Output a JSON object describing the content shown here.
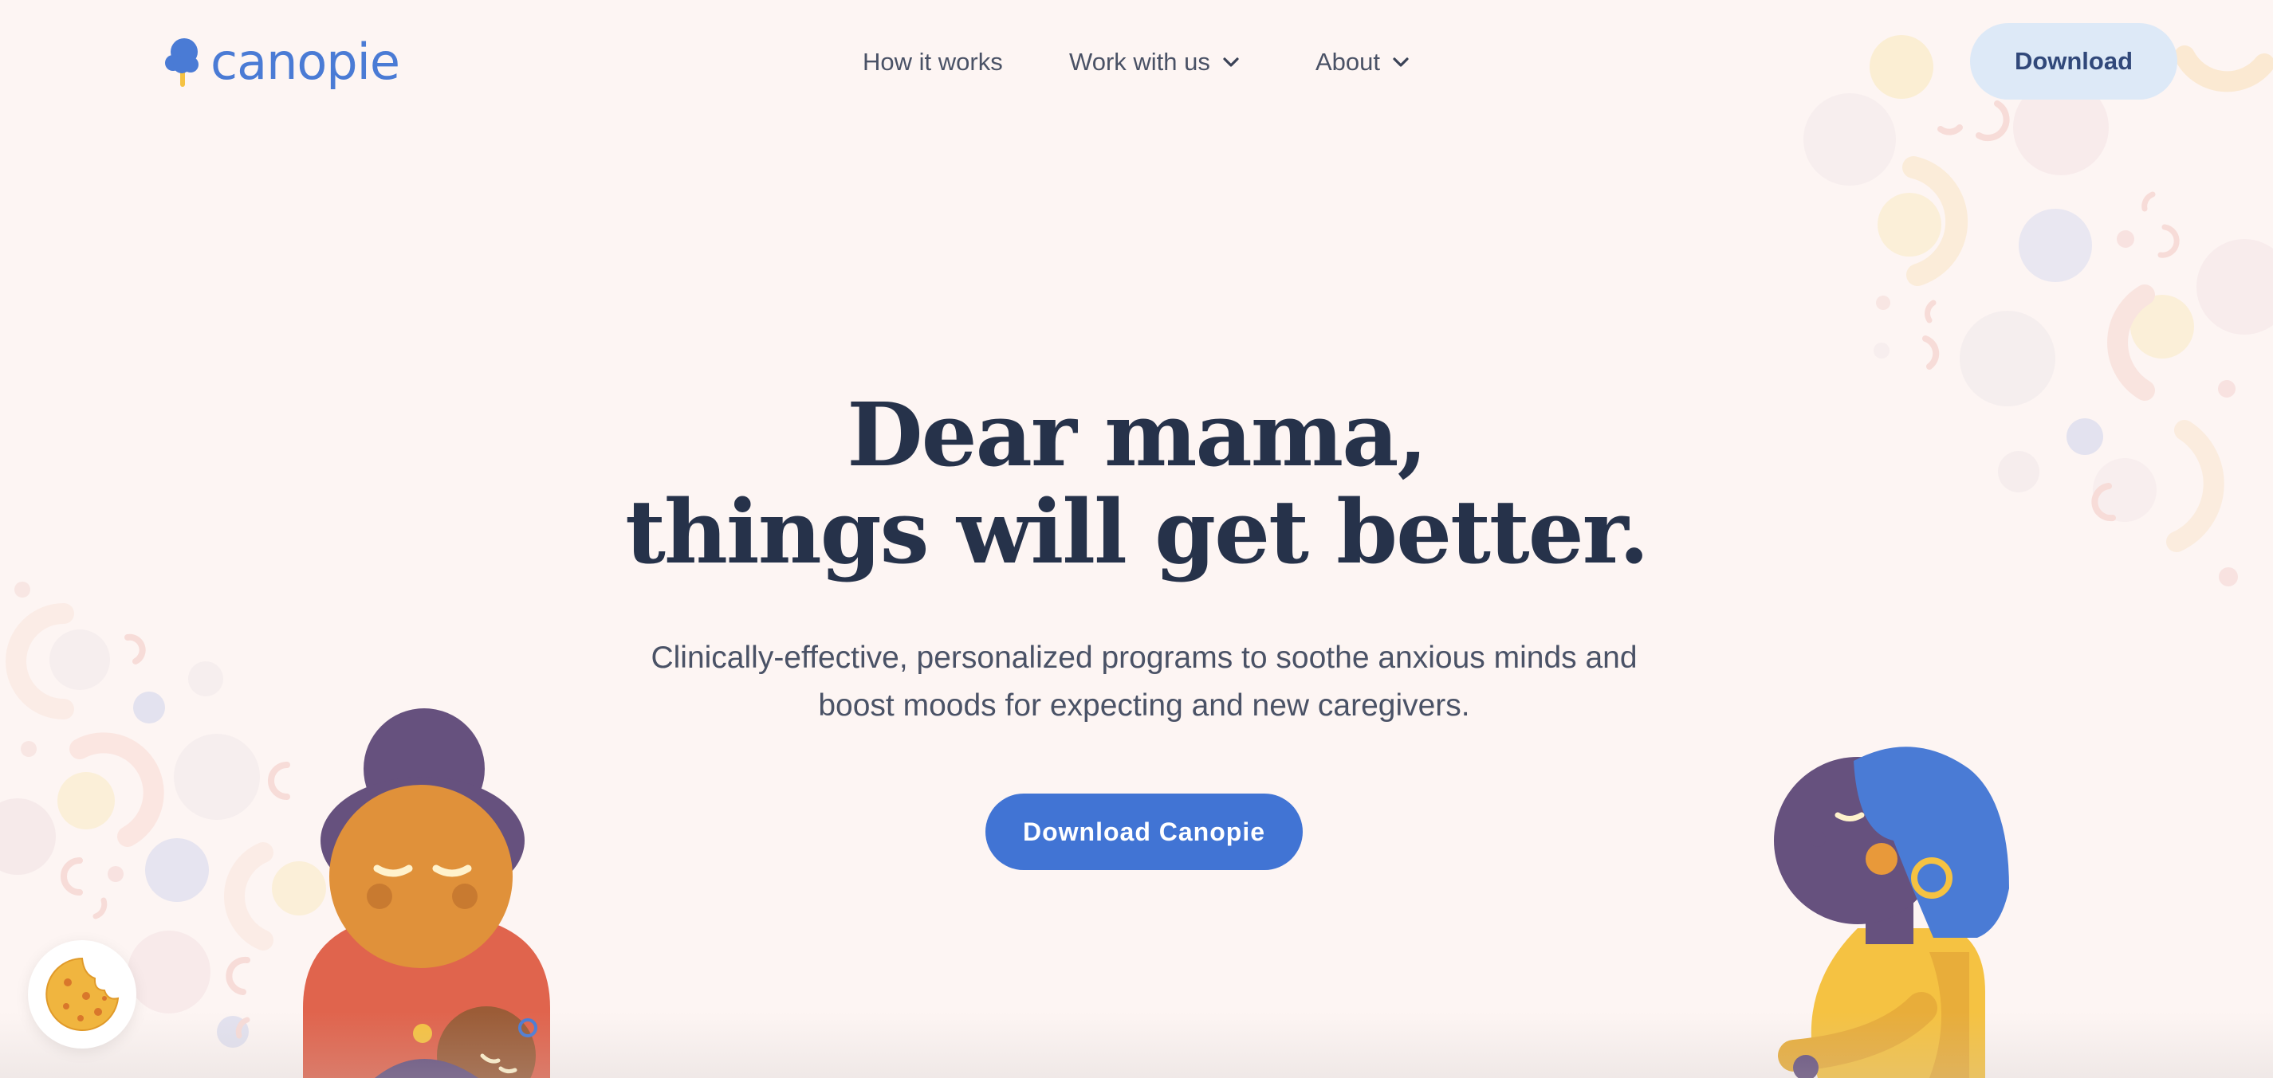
{
  "nav": {
    "logo_text": "canopie",
    "links": [
      {
        "label": "How it works",
        "has_dropdown": false
      },
      {
        "label": "Work with us",
        "has_dropdown": true
      },
      {
        "label": "About",
        "has_dropdown": true
      }
    ],
    "download_label": "Download"
  },
  "hero": {
    "title_line1": "Dear mama,",
    "title_line2": "things will get better.",
    "subtitle_line1": "Clinically-effective, personalized programs to soothe anxious minds and",
    "subtitle_line2": "boost moods for expecting and new caregivers.",
    "cta_label": "Download Canopie"
  },
  "icons": {
    "logo": "canopie-tree-logo-icon",
    "chevron": "chevron-down-icon",
    "cookie": "cookie-icon"
  },
  "colors": {
    "background": "#fdf5f3",
    "brand_blue": "#4174d4",
    "heading": "#26324a",
    "body_text": "#4a5266",
    "download_pill": "#dde9f7"
  }
}
